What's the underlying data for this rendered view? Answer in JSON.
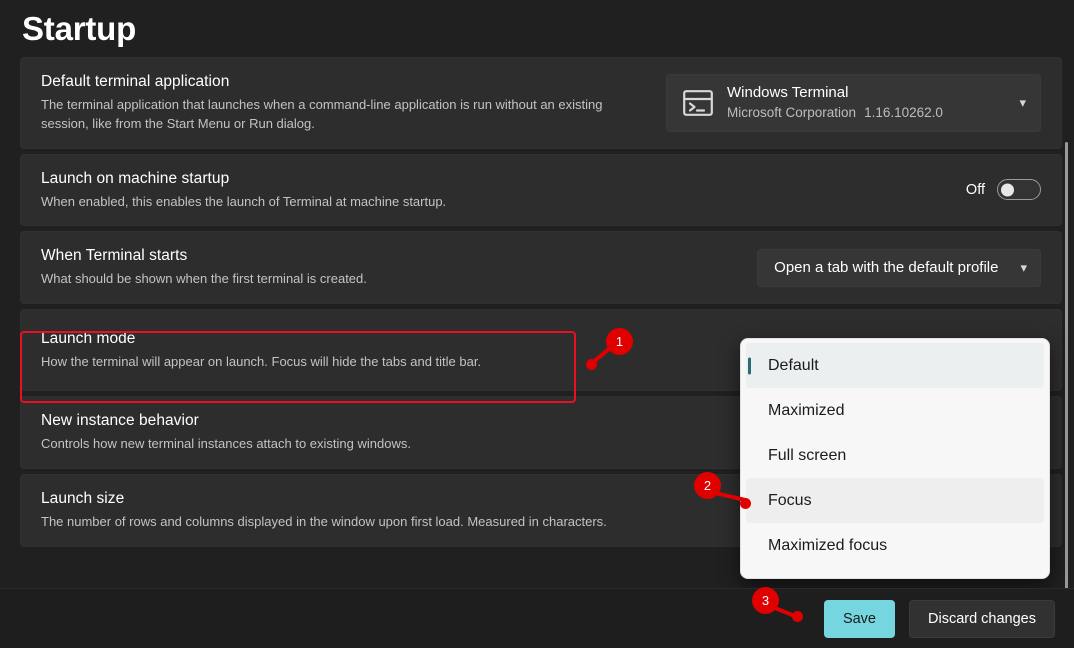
{
  "page": {
    "title": "Startup",
    "background_color": "#202020",
    "card_color": "#2d2d2d"
  },
  "settings": [
    {
      "id": "default-terminal-application",
      "title": "Default terminal application",
      "description": "The terminal application that launches when a command-line application is run without an existing session, like from the Start Menu or Run dialog.",
      "control": "app-combo",
      "app_name": "Windows Terminal",
      "app_publisher": "Microsoft Corporation",
      "app_version": "1.16.10262.0",
      "icon": "terminal-icon",
      "chevron": "chevron-down-icon"
    },
    {
      "id": "launch-on-machine-startup",
      "title": "Launch on machine startup",
      "description": "When enabled, this enables the launch of Terminal at machine startup.",
      "control": "toggle",
      "toggle_state": "Off"
    },
    {
      "id": "when-terminal-starts",
      "title": "When Terminal starts",
      "description": "What should be shown when the first terminal is created.",
      "control": "combo",
      "value": "Open a tab with the default profile",
      "chevron": "chevron-down-icon"
    },
    {
      "id": "launch-mode",
      "title": "Launch mode",
      "description": "How the terminal will appear on launch. Focus will hide the tabs and title bar.",
      "control": "combo-open",
      "highlighted": true
    },
    {
      "id": "new-instance-behavior",
      "title": "New instance behavior",
      "description": "Controls how new terminal instances attach to existing windows.",
      "control": "combo"
    },
    {
      "id": "launch-size",
      "title": "Launch size",
      "description": "The number of rows and columns displayed in the window upon first load. Measured in characters.",
      "control": "combo"
    }
  ],
  "dropdown": {
    "name": "launch-mode-dropdown",
    "options": [
      {
        "label": "Default",
        "state": "selected"
      },
      {
        "label": "Maximized",
        "state": "normal"
      },
      {
        "label": "Full screen",
        "state": "normal"
      },
      {
        "label": "Focus",
        "state": "hover"
      },
      {
        "label": "Maximized focus",
        "state": "normal"
      }
    ],
    "accent_color": "#2b6b73",
    "background_color": "#f7f7f7"
  },
  "actions": {
    "save_label": "Save",
    "discard_label": "Discard changes",
    "save_color": "#76d6e0"
  },
  "annotations": {
    "color": "#e00000",
    "markers": [
      {
        "number": "1",
        "target": "launch-mode-row"
      },
      {
        "number": "2",
        "target": "focus-option"
      },
      {
        "number": "3",
        "target": "save-button"
      }
    ]
  }
}
